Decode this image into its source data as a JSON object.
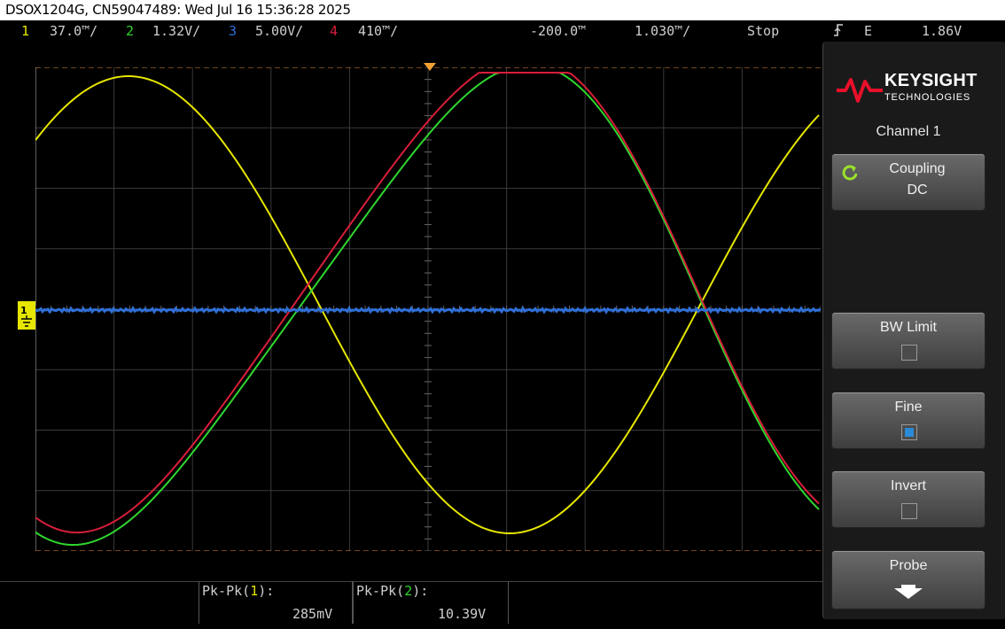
{
  "caption": "DSOX1204G, CN59047489: Wed Jul 16 15:36:28 2025",
  "status": {
    "ch1_num": "1",
    "ch1_scale": "37.0™/",
    "ch2_num": "2",
    "ch2_scale": "1.32V/",
    "ch3_num": "3",
    "ch3_scale": "5.00V/",
    "ch4_num": "4",
    "ch4_scale": "410™/",
    "time_delay": "-200.0™",
    "time_scale": "1.030™/",
    "run_state": "Stop",
    "trigger_mode": "E",
    "trigger_level": "1.86V"
  },
  "colors": {
    "ch1": "#e6e600",
    "ch2": "#2fd62f",
    "ch3": "#2f6fd6",
    "ch4": "#d81e3a",
    "trigger": "#f0a030"
  },
  "side_panel": {
    "brand": "KEYSIGHT",
    "brand_sub": "TECHNOLOGIES",
    "title": "Channel 1",
    "coupling_label": "Coupling",
    "coupling_value": "DC",
    "bw_limit_label": "BW Limit",
    "bw_limit_checked": false,
    "fine_label": "Fine",
    "fine_checked": true,
    "invert_label": "Invert",
    "invert_checked": false,
    "probe_label": "Probe"
  },
  "measurements": [
    {
      "label_prefix": "Pk-Pk(",
      "channel": "1",
      "label_suffix": "):",
      "value": "285mV"
    },
    {
      "label_prefix": "Pk-Pk(",
      "channel": "2",
      "label_suffix": "):",
      "value": "10.39V"
    }
  ],
  "icons": {
    "ground_marker": "ground-marker-icon",
    "trigger_edge": "rising-edge-icon",
    "coupling_cycle": "cycle-arrow-icon",
    "probe_arrow": "down-arrow-icon"
  }
}
